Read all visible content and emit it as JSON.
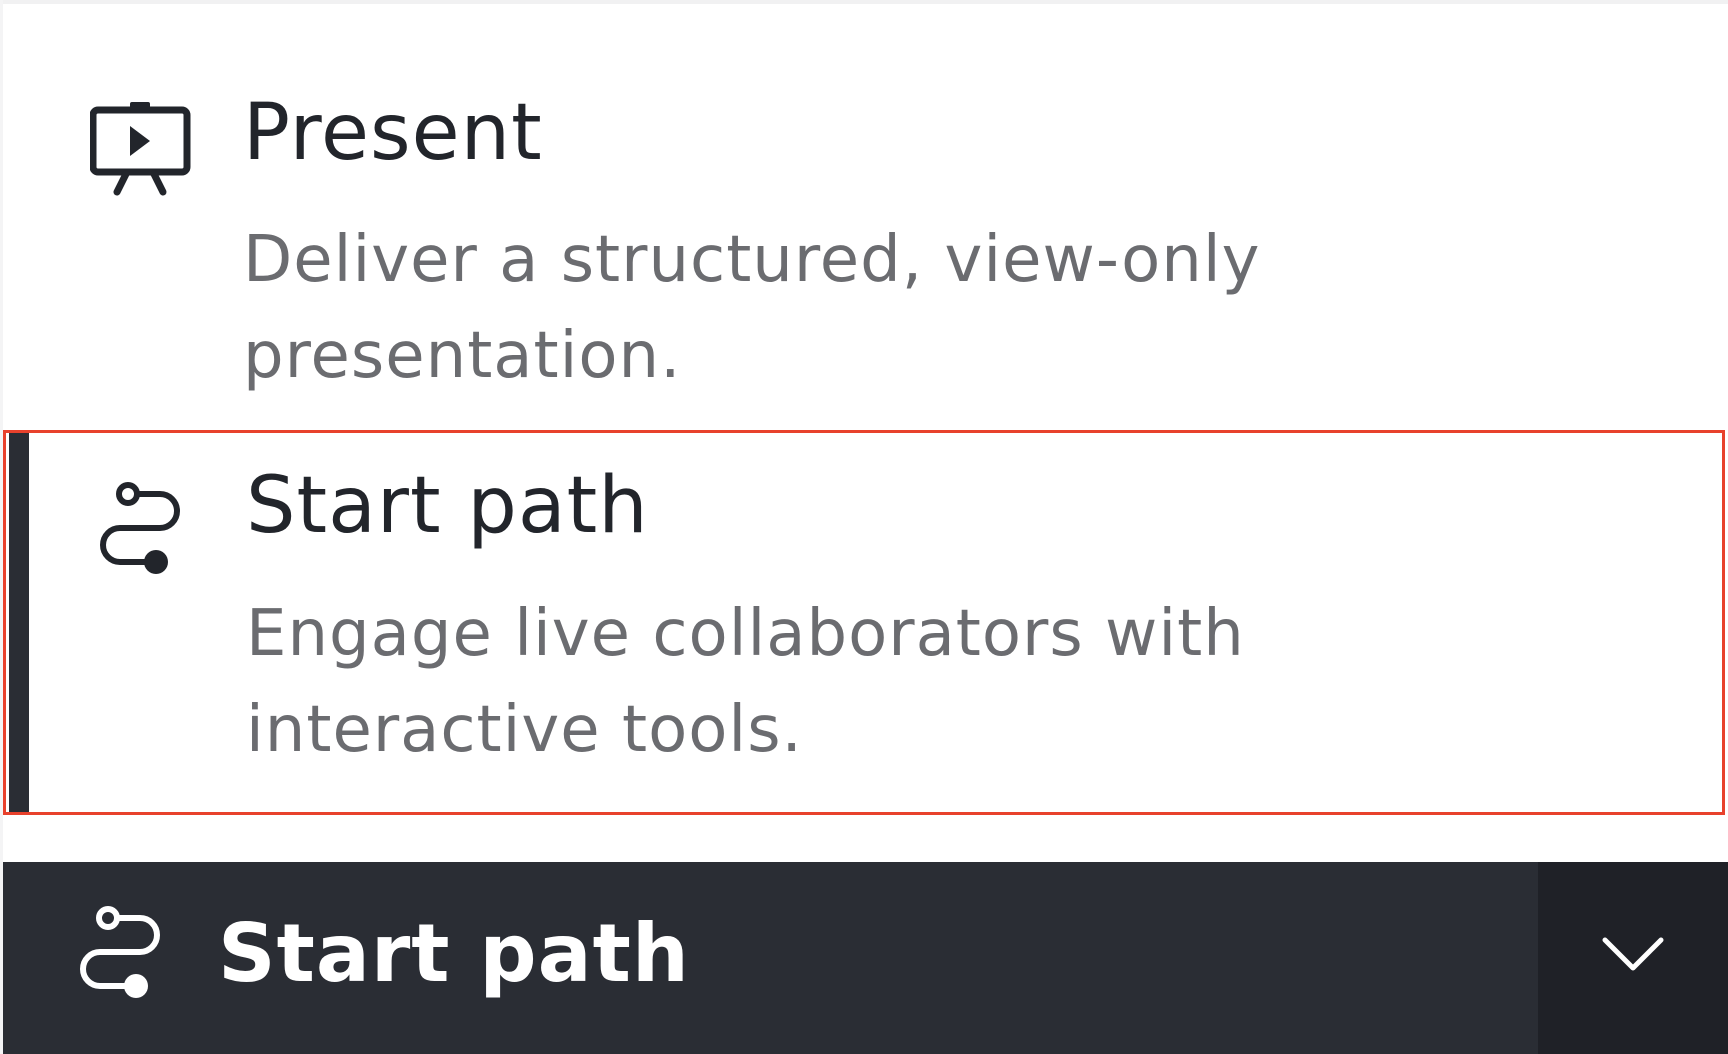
{
  "colors": {
    "text_primary": "#22252b",
    "text_secondary": "#6b6c70",
    "dark_bar": "#2a2d34",
    "dark_toggle": "#1f2127",
    "highlight_outline": "#e8412c"
  },
  "options": [
    {
      "icon": "presentation-easel-play-icon",
      "title": "Present",
      "description": "Deliver a structured, view-only presentation."
    },
    {
      "icon": "path-route-icon",
      "title": "Start path",
      "description": "Engage live collaborators with interactive tools.",
      "selected": true
    }
  ],
  "action_button": {
    "icon": "path-route-icon",
    "label": "Start path",
    "toggle_icon": "chevron-down-icon"
  }
}
